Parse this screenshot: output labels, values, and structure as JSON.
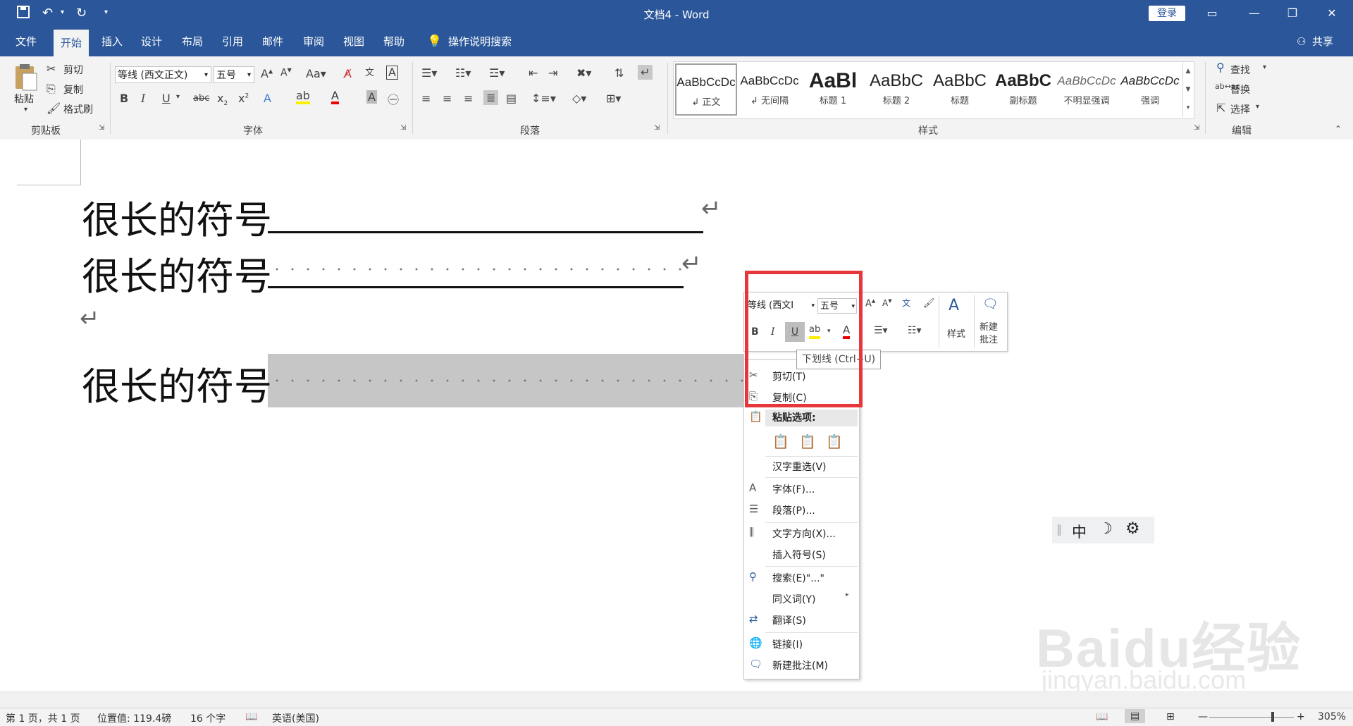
{
  "titlebar": {
    "doc_title": "文档4 - Word",
    "login": "登录"
  },
  "tabs": [
    "文件",
    "开始",
    "插入",
    "设计",
    "布局",
    "引用",
    "邮件",
    "审阅",
    "视图",
    "帮助"
  ],
  "active_tab": "开始",
  "tell_me": "操作说明搜索",
  "share": "共享",
  "clipboard": {
    "paste": "粘贴",
    "cut": "剪切",
    "copy": "复制",
    "format_painter": "格式刷",
    "group": "剪贴板"
  },
  "font": {
    "font_name": "等线 (西文正文)",
    "font_size": "五号",
    "group": "字体"
  },
  "paragraph": {
    "group": "段落"
  },
  "styles": {
    "group": "样式",
    "items": [
      {
        "preview": "AaBbCcDc",
        "name": "正文"
      },
      {
        "preview": "AaBbCcDc",
        "name": "无间隔"
      },
      {
        "preview": "AaBl",
        "name": "标题 1"
      },
      {
        "preview": "AaBbC",
        "name": "标题 2"
      },
      {
        "preview": "AaBbC",
        "name": "标题"
      },
      {
        "preview": "AaBbC",
        "name": "副标题"
      },
      {
        "preview": "AaBbCcDc",
        "name": "不明显强调"
      },
      {
        "preview": "AaBbCcDc",
        "name": "强调"
      }
    ]
  },
  "editing": {
    "find": "查找",
    "replace": "替换",
    "select": "选择",
    "group": "编辑"
  },
  "document": {
    "line_text": "很长的符号"
  },
  "mini_toolbar": {
    "font_name": "等线 (西文I",
    "font_size": "五号",
    "styles": "样式",
    "new_comment_1": "新建",
    "new_comment_2": "批注"
  },
  "tooltip": "下划线 (Ctrl+U)",
  "context_menu": {
    "cut": "剪切(T)",
    "copy": "复制(C)",
    "paste_options": "粘贴选项:",
    "reconversion": "汉字重选(V)",
    "font": "字体(F)...",
    "paragraph": "段落(P)...",
    "text_direction": "文字方向(X)...",
    "insert_symbol": "插入符号(S)",
    "search": "搜索(E)\"...\"",
    "synonyms": "同义词(Y)",
    "translate": "翻译(S)",
    "link": "链接(I)",
    "new_comment": "新建批注(M)"
  },
  "ime": {
    "mode": "中"
  },
  "watermark": {
    "brand": "Baidu经验",
    "url": "jingyan.baidu.com"
  },
  "statusbar": {
    "page": "第 1 页，共 1 页",
    "position": "位置值: 119.4磅",
    "words": "16 个字",
    "language": "英语(美国)",
    "zoom": "305%"
  },
  "colors": {
    "ribbon_blue": "#2b579a",
    "highlight_red": "#e8373b",
    "selection_gray": "#c6c6c6"
  }
}
